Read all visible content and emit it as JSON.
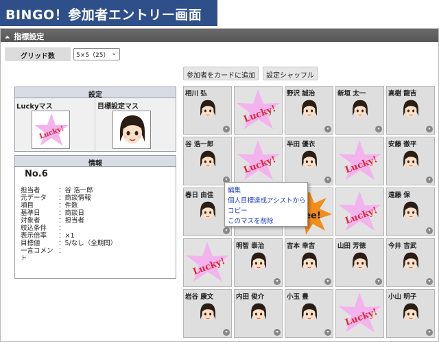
{
  "app": {
    "title": "BINGO！参加者エントリー画面"
  },
  "panel": {
    "collapse_glyph": "⏶",
    "title": "指標設定"
  },
  "grid": {
    "label": "グリッド数",
    "selected": "5×5（25）"
  },
  "toolbar": {
    "add_label": "参加者をカードに追加",
    "shuffle_label": "設定シャッフル"
  },
  "settings": {
    "header": "設定",
    "lucky_label": "Luckyマス",
    "target_label": "目標設定マス"
  },
  "info": {
    "header": "情報",
    "no": "No.6",
    "rows": [
      {
        "k": "担当者",
        "v": "：谷 浩一郎"
      },
      {
        "k": "元データ",
        "v": "：商談情報"
      },
      {
        "k": "項目",
        "v": "：件数"
      },
      {
        "k": "基準日",
        "v": "：商談日"
      },
      {
        "k": "対象者",
        "v": "：担当者"
      },
      {
        "k": "絞込条件",
        "v": "："
      },
      {
        "k": "表示倍率",
        "v": "：×1"
      },
      {
        "k": "目標値",
        "v": "：5/なし（全期間）"
      },
      {
        "k": "一言コメン",
        "v": "："
      },
      {
        "k": "ト",
        "v": ""
      }
    ]
  },
  "bingo": {
    "cells": [
      {
        "type": "person",
        "name": "相川 弘"
      },
      {
        "type": "lucky",
        "name": ""
      },
      {
        "type": "person",
        "name": "野沢 誠治"
      },
      {
        "type": "person",
        "name": "新垣 太一"
      },
      {
        "type": "person",
        "name": "高樹 龍吉"
      },
      {
        "type": "person",
        "name": "谷 浩一郎"
      },
      {
        "type": "lucky",
        "name": ""
      },
      {
        "type": "person",
        "name": "半田 優衣"
      },
      {
        "type": "lucky",
        "name": ""
      },
      {
        "type": "person",
        "name": "安藤 徹平"
      },
      {
        "type": "person",
        "name": "春日 由佳"
      },
      {
        "type": "hidden",
        "name": ""
      },
      {
        "type": "free",
        "name": ""
      },
      {
        "type": "lucky",
        "name": ""
      },
      {
        "type": "person",
        "name": "遠藤 保"
      },
      {
        "type": "lucky",
        "name": ""
      },
      {
        "type": "person",
        "name": "明智 泰治"
      },
      {
        "type": "person",
        "name": "吉本 幸吉"
      },
      {
        "type": "person",
        "name": "山田 芳徳"
      },
      {
        "type": "person",
        "name": "今井 吉武"
      },
      {
        "type": "person",
        "name": "岩谷 康文"
      },
      {
        "type": "person",
        "name": "内田 俊介"
      },
      {
        "type": "person",
        "name": "小玉 豊"
      },
      {
        "type": "lucky",
        "name": ""
      },
      {
        "type": "person",
        "name": "小山 明子"
      }
    ],
    "lucky_text": "Lucky!",
    "free_text": "ee!"
  },
  "context_menu": {
    "items": [
      "編集",
      "個人目標達成アシストから",
      "コピー",
      "このマスを削除"
    ]
  },
  "colors": {
    "title_bg": "#2e4f8a",
    "star": "#f3b4ee",
    "lucky_text": "#e0253a",
    "link": "#1a3cc8",
    "burst": "#f28c1a"
  }
}
